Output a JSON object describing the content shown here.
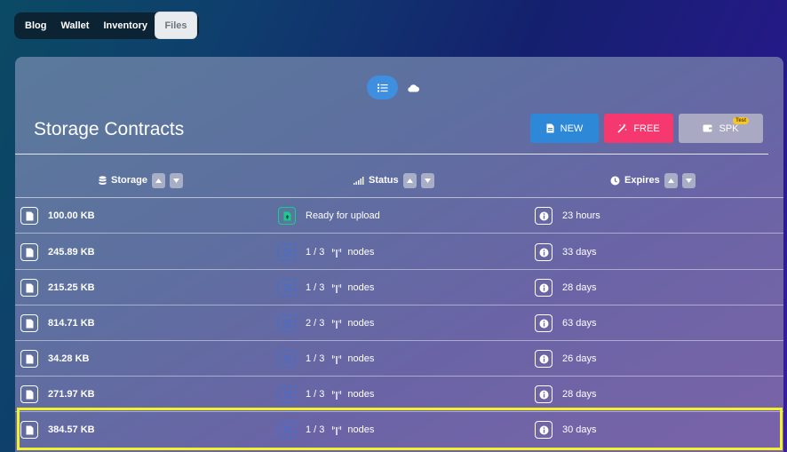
{
  "nav": {
    "tabs": [
      {
        "label": "Blog"
      },
      {
        "label": "Wallet"
      },
      {
        "label": "Inventory"
      },
      {
        "label": "Files"
      }
    ],
    "active": "Files"
  },
  "page": {
    "title": "Storage Contracts",
    "actions": {
      "new_label": "NEW",
      "free_label": "FREE",
      "spk_label": "SPK",
      "spk_badge": "Test"
    }
  },
  "table": {
    "headers": {
      "storage": "Storage",
      "status": "Status",
      "expires": "Expires"
    },
    "rows": [
      {
        "size": "100.00 KB",
        "status": "Ready for upload",
        "expires": "23 hours",
        "ready": true
      },
      {
        "size": "245.89 KB",
        "status_prefix": "1 / 3",
        "status_suffix": "nodes",
        "expires": "33 days"
      },
      {
        "size": "215.25 KB",
        "status_prefix": "1 / 3",
        "status_suffix": "nodes",
        "expires": "28 days"
      },
      {
        "size": "814.71 KB",
        "status_prefix": "2 / 3",
        "status_suffix": "nodes",
        "expires": "63 days"
      },
      {
        "size": "34.28 KB",
        "status_prefix": "1 / 3",
        "status_suffix": "nodes",
        "expires": "26 days"
      },
      {
        "size": "271.97 KB",
        "status_prefix": "1 / 3",
        "status_suffix": "nodes",
        "expires": "28 days"
      },
      {
        "size": "384.57 KB",
        "status_prefix": "1 / 3",
        "status_suffix": "nodes",
        "expires": "30 days"
      }
    ]
  },
  "icons": {
    "list_view": "list-icon",
    "cloud_view": "cloud-icon",
    "storage_header": "database-icon",
    "status_header": "signal-icon",
    "expires_header": "clock-icon"
  },
  "colors": {
    "new": "#2e88d8",
    "free": "#f5386d",
    "spk": "#a9a9c3",
    "ready": "#1fc98c",
    "highlight": "#f2f22a"
  }
}
